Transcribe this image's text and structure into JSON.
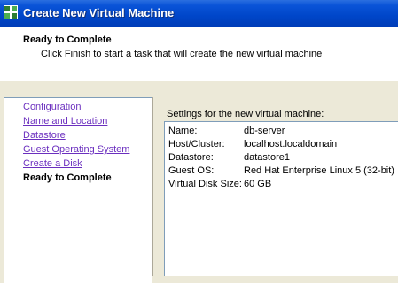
{
  "window": {
    "title": "Create New Virtual Machine",
    "icon": "vm-wizard-icon"
  },
  "header": {
    "title": "Ready to Complete",
    "description": "Click Finish to start a task that will create the new virtual machine"
  },
  "nav": {
    "items": [
      {
        "label": "Configuration",
        "state": "link"
      },
      {
        "label": "Name and Location",
        "state": "link"
      },
      {
        "label": "Datastore",
        "state": "link"
      },
      {
        "label": "Guest Operating System",
        "state": "link"
      },
      {
        "label": "Create a Disk",
        "state": "link"
      },
      {
        "label": "Ready to Complete",
        "state": "current"
      }
    ],
    "link_color": "#6b2fbf"
  },
  "settings": {
    "label": "Settings for the new virtual machine:",
    "rows": [
      {
        "key": "Name:",
        "value": "db-server"
      },
      {
        "key": "Host/Cluster:",
        "value": "localhost.localdomain"
      },
      {
        "key": "Datastore:",
        "value": "datastore1"
      },
      {
        "key": "Guest OS:",
        "value": "Red Hat Enterprise Linux 5 (32-bit)"
      },
      {
        "key": "Virtual Disk Size:",
        "value": "60 GB"
      }
    ]
  },
  "colors": {
    "titlebar": "#0a54d8",
    "dialog_bg": "#ece9d8",
    "border": "#7f9db9"
  }
}
